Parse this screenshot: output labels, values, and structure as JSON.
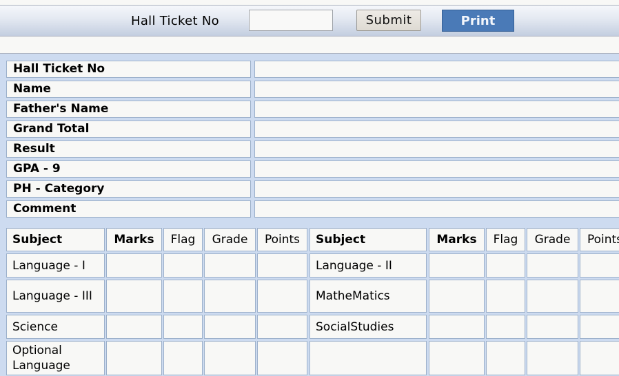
{
  "search_bar": {
    "label": "Hall Ticket No",
    "input_value": "",
    "submit_label": "Submit",
    "print_label": "Print"
  },
  "student_info": [
    {
      "label": "Hall Ticket No",
      "value": ""
    },
    {
      "label": "Name",
      "value": ""
    },
    {
      "label": "Father's Name",
      "value": ""
    },
    {
      "label": "Grand Total",
      "value": ""
    },
    {
      "label": "Result",
      "value": ""
    },
    {
      "label": "GPA - 9",
      "value": ""
    },
    {
      "label": "PH - Category",
      "value": ""
    },
    {
      "label": "Comment",
      "value": ""
    }
  ],
  "marks_table": {
    "headers": [
      "Subject",
      "Marks",
      "Flag",
      "Grade",
      "Points",
      "Subject",
      "Marks",
      "Flag",
      "Grade",
      "Points"
    ],
    "rows": [
      [
        "Language - I",
        "",
        "",
        "",
        "",
        "Language - II",
        "",
        "",
        "",
        ""
      ],
      [
        "Language - III",
        "",
        "",
        "",
        "",
        "MatheMatics",
        "",
        "",
        "",
        ""
      ],
      [
        "Science",
        "",
        "",
        "",
        "",
        "SocialStudies",
        "",
        "",
        "",
        ""
      ],
      [
        "Optional Language",
        "",
        "",
        "",
        "",
        "",
        "",
        "",
        "",
        ""
      ]
    ]
  },
  "colors": {
    "print_button": "#4a7ab7",
    "panel_background": "#cddbf0",
    "cell_border": "#9cb0ca"
  }
}
